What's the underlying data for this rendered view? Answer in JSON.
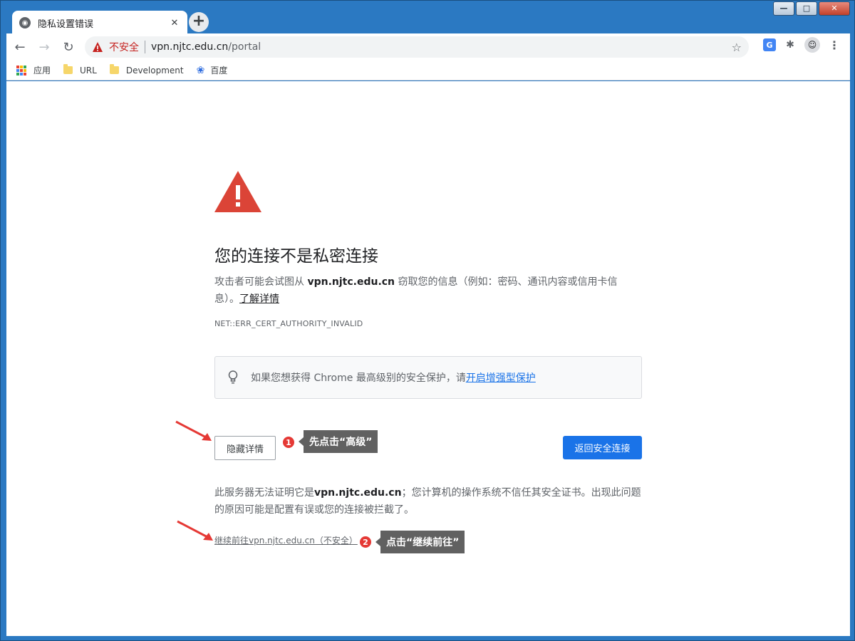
{
  "tab": {
    "title": "隐私设置错误",
    "close": "✕"
  },
  "newtab": "+",
  "window_controls": {
    "minimize": "—",
    "maximize": "□",
    "close": "✕"
  },
  "toolbar": {
    "back": "←",
    "forward": "→",
    "reload": "↻",
    "not_secure": "不安全",
    "url_host": "vpn.njtc.edu.cn",
    "url_path": "/portal",
    "star": "☆",
    "translate": "G",
    "extensions": "✱",
    "avatar": "☺",
    "menu": "⋮"
  },
  "bookmarks": [
    {
      "label": "应用",
      "icon": "apps-grid-icon"
    },
    {
      "label": "URL",
      "icon": "folder-icon"
    },
    {
      "label": "Development",
      "icon": "folder-icon"
    },
    {
      "label": "百度",
      "icon": "baidu-paw-icon"
    }
  ],
  "page": {
    "headline": "您的连接不是私密连接",
    "desc_prefix": "攻击者可能会试图从 ",
    "desc_host": "vpn.njtc.edu.cn",
    "desc_suffix": " 窃取您的信息（例如：密码、通讯内容或信用卡信息）。",
    "learn_more": "了解详情",
    "error_code": "NET::ERR_CERT_AUTHORITY_INVALID",
    "enhanced_text": "如果您想获得 Chrome 最高级别的安全保护，请",
    "enhanced_link": "开启增强型保护",
    "hide_details": "隐藏详情",
    "back_to_safety": "返回安全连接",
    "explain_prefix": "此服务器无法证明它是",
    "explain_host": "vpn.njtc.edu.cn",
    "explain_suffix": "；您计算机的操作系统不信任其安全证书。出现此问题的原因可能是配置有误或您的连接被拦截了。",
    "proceed_link": "继续前往vpn.njtc.edu.cn（不安全）"
  },
  "annotations": [
    {
      "badge": "1",
      "text": "先点击“高级”"
    },
    {
      "badge": "2",
      "text": "点击“继续前往”"
    }
  ],
  "colors": {
    "warning_red": "#db4437",
    "link_blue": "#1a73e8",
    "primary_button": "#1a73e8",
    "not_secure_red": "#c5221f",
    "annotation_red": "#e53935",
    "callout_gray": "#616161"
  }
}
